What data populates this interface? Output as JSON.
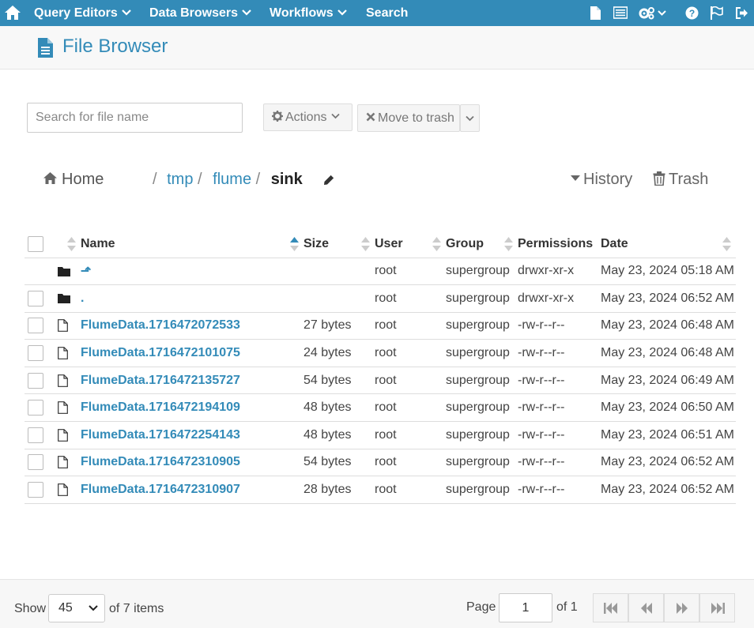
{
  "nav": {
    "menus": [
      {
        "label": "Query Editors",
        "has_dropdown": true
      },
      {
        "label": "Data Browsers",
        "has_dropdown": true
      },
      {
        "label": "Workflows",
        "has_dropdown": true
      },
      {
        "label": "Search",
        "has_dropdown": false
      }
    ],
    "right_icons": [
      "file-icon",
      "list-icon",
      "cogs-icon",
      "help-icon",
      "flag-icon",
      "sign-out-icon"
    ]
  },
  "header": {
    "title": "File Browser",
    "icon": "file-text-icon"
  },
  "toolbar": {
    "search_placeholder": "Search for file name",
    "search_value": "",
    "actions_label": "Actions",
    "move_to_trash_label": "Move to trash"
  },
  "breadcrumb": {
    "home_label": "Home",
    "separator": "/",
    "path": [
      "tmp",
      "flume"
    ],
    "current": "sink",
    "history_label": "History",
    "trash_label": "Trash"
  },
  "table": {
    "columns": [
      "Name",
      "Size",
      "User",
      "Group",
      "Permissions",
      "Date"
    ],
    "sorted_column": "Name",
    "sort_direction": "ascending",
    "rows": [
      {
        "type": "dir",
        "name": "⬏",
        "size": "",
        "user": "root",
        "group": "supergroup",
        "permissions": "drwxr-xr-x",
        "date": "May 23, 2024 05:18 AM",
        "selectable": false
      },
      {
        "type": "dir",
        "name": ".",
        "size": "",
        "user": "root",
        "group": "supergroup",
        "permissions": "drwxr-xr-x",
        "date": "May 23, 2024 06:52 AM",
        "selectable": true
      },
      {
        "type": "file",
        "name": "FlumeData.1716472072533",
        "size": "27 bytes",
        "user": "root",
        "group": "supergroup",
        "permissions": "-rw-r--r--",
        "date": "May 23, 2024 06:48 AM",
        "selectable": true
      },
      {
        "type": "file",
        "name": "FlumeData.1716472101075",
        "size": "24 bytes",
        "user": "root",
        "group": "supergroup",
        "permissions": "-rw-r--r--",
        "date": "May 23, 2024 06:48 AM",
        "selectable": true
      },
      {
        "type": "file",
        "name": "FlumeData.1716472135727",
        "size": "54 bytes",
        "user": "root",
        "group": "supergroup",
        "permissions": "-rw-r--r--",
        "date": "May 23, 2024 06:49 AM",
        "selectable": true
      },
      {
        "type": "file",
        "name": "FlumeData.1716472194109",
        "size": "48 bytes",
        "user": "root",
        "group": "supergroup",
        "permissions": "-rw-r--r--",
        "date": "May 23, 2024 06:50 AM",
        "selectable": true
      },
      {
        "type": "file",
        "name": "FlumeData.1716472254143",
        "size": "48 bytes",
        "user": "root",
        "group": "supergroup",
        "permissions": "-rw-r--r--",
        "date": "May 23, 2024 06:51 AM",
        "selectable": true
      },
      {
        "type": "file",
        "name": "FlumeData.1716472310905",
        "size": "54 bytes",
        "user": "root",
        "group": "supergroup",
        "permissions": "-rw-r--r--",
        "date": "May 23, 2024 06:52 AM",
        "selectable": true
      },
      {
        "type": "file",
        "name": "FlumeData.1716472310907",
        "size": "28 bytes",
        "user": "root",
        "group": "supergroup",
        "permissions": "-rw-r--r--",
        "date": "May 23, 2024 06:52 AM",
        "selectable": true
      }
    ]
  },
  "footer": {
    "show_label": "Show",
    "page_size": "45",
    "items_label": "of 7 items",
    "page_label": "Page",
    "page_value": "1",
    "of_pages_label": "of 1"
  },
  "colors": {
    "brand": "#338bb8",
    "link": "#338bb8",
    "nav_text": "#ffffff"
  }
}
